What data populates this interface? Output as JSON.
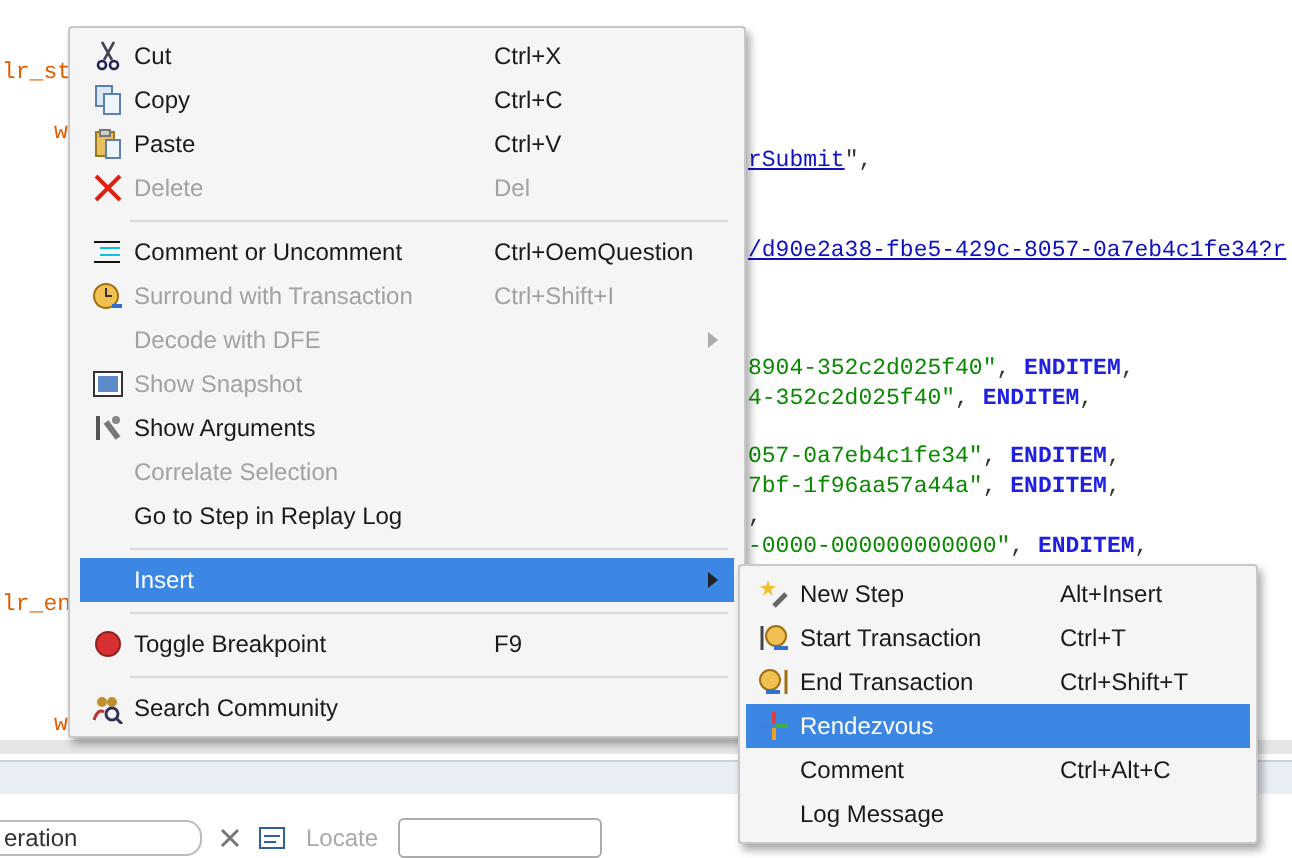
{
  "editor": {
    "lines": [
      {
        "kind": "code",
        "left": [
          {
            "kind": "function",
            "text": "lr_st"
          }
        ]
      },
      {
        "kind": "blank"
      },
      {
        "kind": "code",
        "indent": true,
        "left": [
          {
            "kind": "function",
            "text": "w"
          }
        ]
      },
      {
        "kind": "code",
        "right": [
          {
            "kind": "link",
            "text": "rSubmit"
          },
          {
            "kind": "plain",
            "text": "\","
          }
        ]
      },
      {
        "kind": "blank"
      },
      {
        "kind": "blank"
      },
      {
        "kind": "code",
        "right": [
          {
            "kind": "link",
            "text": "/d90e2a38-fbe5-429c-8057-0a7eb4c1fe34?r"
          }
        ]
      },
      {
        "kind": "blank"
      },
      {
        "kind": "blank"
      },
      {
        "kind": "blank"
      },
      {
        "kind": "code",
        "right": [
          {
            "kind": "string",
            "text": "8904-352c2d025f40\""
          },
          {
            "kind": "plain",
            "text": ", "
          },
          {
            "kind": "keyword",
            "text": "ENDITEM"
          },
          {
            "kind": "plain",
            "text": ","
          }
        ]
      },
      {
        "kind": "code",
        "right": [
          {
            "kind": "string",
            "text": "4-352c2d025f40\""
          },
          {
            "kind": "plain",
            "text": ", "
          },
          {
            "kind": "keyword",
            "text": "ENDITEM"
          },
          {
            "kind": "plain",
            "text": ","
          }
        ]
      },
      {
        "kind": "blank"
      },
      {
        "kind": "code",
        "right": [
          {
            "kind": "string",
            "text": "057-0a7eb4c1fe34\""
          },
          {
            "kind": "plain",
            "text": ", "
          },
          {
            "kind": "keyword",
            "text": "ENDITEM"
          },
          {
            "kind": "plain",
            "text": ","
          }
        ]
      },
      {
        "kind": "code",
        "right": [
          {
            "kind": "string",
            "text": "7bf-1f96aa57a44a\""
          },
          {
            "kind": "plain",
            "text": ", "
          },
          {
            "kind": "keyword",
            "text": "ENDITEM"
          },
          {
            "kind": "plain",
            "text": ","
          }
        ]
      },
      {
        "kind": "code",
        "right": [
          {
            "kind": "plain",
            "text": ","
          }
        ]
      },
      {
        "kind": "code",
        "right": [
          {
            "kind": "string",
            "text": "-0000-000000000000\""
          },
          {
            "kind": "plain",
            "text": ", "
          },
          {
            "kind": "keyword",
            "text": "ENDITEM"
          },
          {
            "kind": "plain",
            "text": ","
          }
        ]
      },
      {
        "kind": "blank"
      },
      {
        "kind": "code",
        "left": [
          {
            "kind": "function",
            "text": "lr_en"
          }
        ]
      },
      {
        "kind": "blank"
      },
      {
        "kind": "blank"
      },
      {
        "kind": "blank"
      },
      {
        "kind": "code",
        "indent": true,
        "left": [
          {
            "kind": "function",
            "text": "w"
          }
        ]
      }
    ]
  },
  "toolbar": {
    "dropdown": {
      "value": "eration"
    },
    "locate": {
      "label": "Locate",
      "disabled": true
    }
  },
  "context_menu": {
    "items": [
      {
        "kind": "item",
        "label": "Cut",
        "shortcut": "Ctrl+X",
        "disabled": false,
        "selected": false
      },
      {
        "kind": "item",
        "label": "Copy",
        "shortcut": "Ctrl+C",
        "disabled": false,
        "selected": false
      },
      {
        "kind": "item",
        "label": "Paste",
        "shortcut": "Ctrl+V",
        "disabled": false,
        "selected": false
      },
      {
        "kind": "item",
        "label": "Delete",
        "shortcut": "Del",
        "disabled": true,
        "selected": false
      },
      {
        "kind": "separator"
      },
      {
        "kind": "item",
        "label": "Comment or Uncomment",
        "shortcut": "Ctrl+OemQuestion",
        "disabled": false,
        "selected": false
      },
      {
        "kind": "item",
        "label": "Surround with Transaction",
        "shortcut": "Ctrl+Shift+I",
        "disabled": true,
        "selected": false
      },
      {
        "kind": "item",
        "label": "Decode with DFE",
        "disabled": true,
        "selected": false,
        "has_submenu": true
      },
      {
        "kind": "item",
        "label": "Show Snapshot",
        "disabled": true,
        "selected": false
      },
      {
        "kind": "item",
        "label": "Show Arguments",
        "disabled": false,
        "selected": false
      },
      {
        "kind": "item",
        "label": "Correlate Selection",
        "disabled": true,
        "selected": false
      },
      {
        "kind": "item",
        "label": "Go to Step in Replay Log",
        "disabled": false,
        "selected": false
      },
      {
        "kind": "separator"
      },
      {
        "kind": "item",
        "label": "Insert",
        "disabled": false,
        "selected": true,
        "has_submenu": true
      },
      {
        "kind": "separator"
      },
      {
        "kind": "item",
        "label": "Toggle Breakpoint",
        "shortcut": "F9",
        "disabled": false,
        "selected": false
      },
      {
        "kind": "separator"
      },
      {
        "kind": "item",
        "label": "Search Community",
        "disabled": false,
        "selected": false
      }
    ]
  },
  "submenu": {
    "items": [
      {
        "label": "New Step",
        "shortcut": "Alt+Insert",
        "selected": false
      },
      {
        "label": "Start Transaction",
        "shortcut": "Ctrl+T",
        "selected": false
      },
      {
        "label": "End Transaction",
        "shortcut": "Ctrl+Shift+T",
        "selected": false
      },
      {
        "label": "Rendezvous",
        "selected": true
      },
      {
        "label": "Comment",
        "shortcut": "Ctrl+Alt+C",
        "selected": false
      },
      {
        "label": "Log Message",
        "selected": false
      }
    ]
  }
}
